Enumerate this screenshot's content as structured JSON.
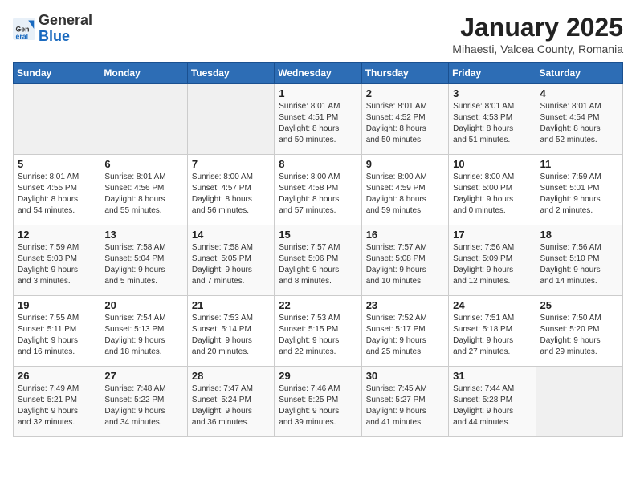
{
  "header": {
    "logo_general": "General",
    "logo_blue": "Blue",
    "title": "January 2025",
    "subtitle": "Mihaesti, Valcea County, Romania"
  },
  "weekdays": [
    "Sunday",
    "Monday",
    "Tuesday",
    "Wednesday",
    "Thursday",
    "Friday",
    "Saturday"
  ],
  "weeks": [
    [
      {
        "day": "",
        "info": ""
      },
      {
        "day": "",
        "info": ""
      },
      {
        "day": "",
        "info": ""
      },
      {
        "day": "1",
        "info": "Sunrise: 8:01 AM\nSunset: 4:51 PM\nDaylight: 8 hours\nand 50 minutes."
      },
      {
        "day": "2",
        "info": "Sunrise: 8:01 AM\nSunset: 4:52 PM\nDaylight: 8 hours\nand 50 minutes."
      },
      {
        "day": "3",
        "info": "Sunrise: 8:01 AM\nSunset: 4:53 PM\nDaylight: 8 hours\nand 51 minutes."
      },
      {
        "day": "4",
        "info": "Sunrise: 8:01 AM\nSunset: 4:54 PM\nDaylight: 8 hours\nand 52 minutes."
      }
    ],
    [
      {
        "day": "5",
        "info": "Sunrise: 8:01 AM\nSunset: 4:55 PM\nDaylight: 8 hours\nand 54 minutes."
      },
      {
        "day": "6",
        "info": "Sunrise: 8:01 AM\nSunset: 4:56 PM\nDaylight: 8 hours\nand 55 minutes."
      },
      {
        "day": "7",
        "info": "Sunrise: 8:00 AM\nSunset: 4:57 PM\nDaylight: 8 hours\nand 56 minutes."
      },
      {
        "day": "8",
        "info": "Sunrise: 8:00 AM\nSunset: 4:58 PM\nDaylight: 8 hours\nand 57 minutes."
      },
      {
        "day": "9",
        "info": "Sunrise: 8:00 AM\nSunset: 4:59 PM\nDaylight: 8 hours\nand 59 minutes."
      },
      {
        "day": "10",
        "info": "Sunrise: 8:00 AM\nSunset: 5:00 PM\nDaylight: 9 hours\nand 0 minutes."
      },
      {
        "day": "11",
        "info": "Sunrise: 7:59 AM\nSunset: 5:01 PM\nDaylight: 9 hours\nand 2 minutes."
      }
    ],
    [
      {
        "day": "12",
        "info": "Sunrise: 7:59 AM\nSunset: 5:03 PM\nDaylight: 9 hours\nand 3 minutes."
      },
      {
        "day": "13",
        "info": "Sunrise: 7:58 AM\nSunset: 5:04 PM\nDaylight: 9 hours\nand 5 minutes."
      },
      {
        "day": "14",
        "info": "Sunrise: 7:58 AM\nSunset: 5:05 PM\nDaylight: 9 hours\nand 7 minutes."
      },
      {
        "day": "15",
        "info": "Sunrise: 7:57 AM\nSunset: 5:06 PM\nDaylight: 9 hours\nand 8 minutes."
      },
      {
        "day": "16",
        "info": "Sunrise: 7:57 AM\nSunset: 5:08 PM\nDaylight: 9 hours\nand 10 minutes."
      },
      {
        "day": "17",
        "info": "Sunrise: 7:56 AM\nSunset: 5:09 PM\nDaylight: 9 hours\nand 12 minutes."
      },
      {
        "day": "18",
        "info": "Sunrise: 7:56 AM\nSunset: 5:10 PM\nDaylight: 9 hours\nand 14 minutes."
      }
    ],
    [
      {
        "day": "19",
        "info": "Sunrise: 7:55 AM\nSunset: 5:11 PM\nDaylight: 9 hours\nand 16 minutes."
      },
      {
        "day": "20",
        "info": "Sunrise: 7:54 AM\nSunset: 5:13 PM\nDaylight: 9 hours\nand 18 minutes."
      },
      {
        "day": "21",
        "info": "Sunrise: 7:53 AM\nSunset: 5:14 PM\nDaylight: 9 hours\nand 20 minutes."
      },
      {
        "day": "22",
        "info": "Sunrise: 7:53 AM\nSunset: 5:15 PM\nDaylight: 9 hours\nand 22 minutes."
      },
      {
        "day": "23",
        "info": "Sunrise: 7:52 AM\nSunset: 5:17 PM\nDaylight: 9 hours\nand 25 minutes."
      },
      {
        "day": "24",
        "info": "Sunrise: 7:51 AM\nSunset: 5:18 PM\nDaylight: 9 hours\nand 27 minutes."
      },
      {
        "day": "25",
        "info": "Sunrise: 7:50 AM\nSunset: 5:20 PM\nDaylight: 9 hours\nand 29 minutes."
      }
    ],
    [
      {
        "day": "26",
        "info": "Sunrise: 7:49 AM\nSunset: 5:21 PM\nDaylight: 9 hours\nand 32 minutes."
      },
      {
        "day": "27",
        "info": "Sunrise: 7:48 AM\nSunset: 5:22 PM\nDaylight: 9 hours\nand 34 minutes."
      },
      {
        "day": "28",
        "info": "Sunrise: 7:47 AM\nSunset: 5:24 PM\nDaylight: 9 hours\nand 36 minutes."
      },
      {
        "day": "29",
        "info": "Sunrise: 7:46 AM\nSunset: 5:25 PM\nDaylight: 9 hours\nand 39 minutes."
      },
      {
        "day": "30",
        "info": "Sunrise: 7:45 AM\nSunset: 5:27 PM\nDaylight: 9 hours\nand 41 minutes."
      },
      {
        "day": "31",
        "info": "Sunrise: 7:44 AM\nSunset: 5:28 PM\nDaylight: 9 hours\nand 44 minutes."
      },
      {
        "day": "",
        "info": ""
      }
    ]
  ]
}
